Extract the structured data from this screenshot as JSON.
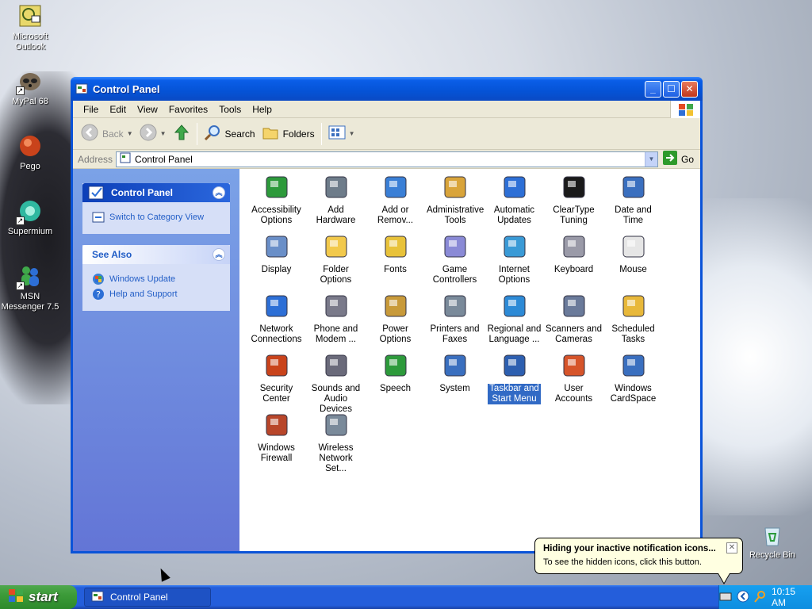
{
  "desktop": {
    "icons": [
      {
        "label": "Microsoft Outlook"
      },
      {
        "label": "MyPal 68"
      },
      {
        "label": "Pego"
      },
      {
        "label": "Supermium"
      },
      {
        "label": "MSN Messenger 7.5"
      },
      {
        "label": "Recycle Bin"
      }
    ]
  },
  "window": {
    "title": "Control Panel",
    "menu": [
      "File",
      "Edit",
      "View",
      "Favorites",
      "Tools",
      "Help"
    ],
    "toolbar": {
      "back": "Back",
      "search": "Search",
      "folders": "Folders"
    },
    "address": {
      "label": "Address",
      "value": "Control Panel",
      "go": "Go"
    }
  },
  "leftpane": {
    "panel1": {
      "title": "Control Panel",
      "link": "Switch to Category View"
    },
    "panel2": {
      "title": "See Also",
      "links": [
        "Windows Update",
        "Help and Support"
      ]
    }
  },
  "applets": [
    {
      "l1": "Accessibility",
      "l2": "Options"
    },
    {
      "l1": "Add Hardware",
      "l2": ""
    },
    {
      "l1": "Add or",
      "l2": "Remov..."
    },
    {
      "l1": "Administrative",
      "l2": "Tools"
    },
    {
      "l1": "Automatic",
      "l2": "Updates"
    },
    {
      "l1": "ClearType",
      "l2": "Tuning"
    },
    {
      "l1": "Date and Time",
      "l2": ""
    },
    {
      "l1": "Display",
      "l2": ""
    },
    {
      "l1": "Folder Options",
      "l2": ""
    },
    {
      "l1": "Fonts",
      "l2": ""
    },
    {
      "l1": "Game",
      "l2": "Controllers"
    },
    {
      "l1": "Internet",
      "l2": "Options"
    },
    {
      "l1": "Keyboard",
      "l2": ""
    },
    {
      "l1": "Mouse",
      "l2": ""
    },
    {
      "l1": "Network",
      "l2": "Connections"
    },
    {
      "l1": "Phone and",
      "l2": "Modem ..."
    },
    {
      "l1": "Power Options",
      "l2": ""
    },
    {
      "l1": "Printers and",
      "l2": "Faxes"
    },
    {
      "l1": "Regional and",
      "l2": "Language ..."
    },
    {
      "l1": "Scanners and",
      "l2": "Cameras"
    },
    {
      "l1": "Scheduled",
      "l2": "Tasks"
    },
    {
      "l1": "Security",
      "l2": "Center"
    },
    {
      "l1": "Sounds and",
      "l2": "Audio Devices"
    },
    {
      "l1": "Speech",
      "l2": ""
    },
    {
      "l1": "System",
      "l2": ""
    },
    {
      "l1": "Taskbar and",
      "l2": "Start Menu"
    },
    {
      "l1": "User Accounts",
      "l2": ""
    },
    {
      "l1": "Windows",
      "l2": "CardSpace"
    },
    {
      "l1": "Windows",
      "l2": "Firewall"
    },
    {
      "l1": "Wireless",
      "l2": "Network Set..."
    }
  ],
  "taskbar": {
    "start": "start",
    "task": "Control Panel",
    "clock": "10:15 AM"
  },
  "balloon": {
    "title": "Hiding your inactive notification icons...",
    "text": "To see the hidden icons, click this button."
  },
  "colors": {
    "selection": "#316ac5",
    "link": "#215dc6",
    "title_bar": "#0553d6"
  }
}
